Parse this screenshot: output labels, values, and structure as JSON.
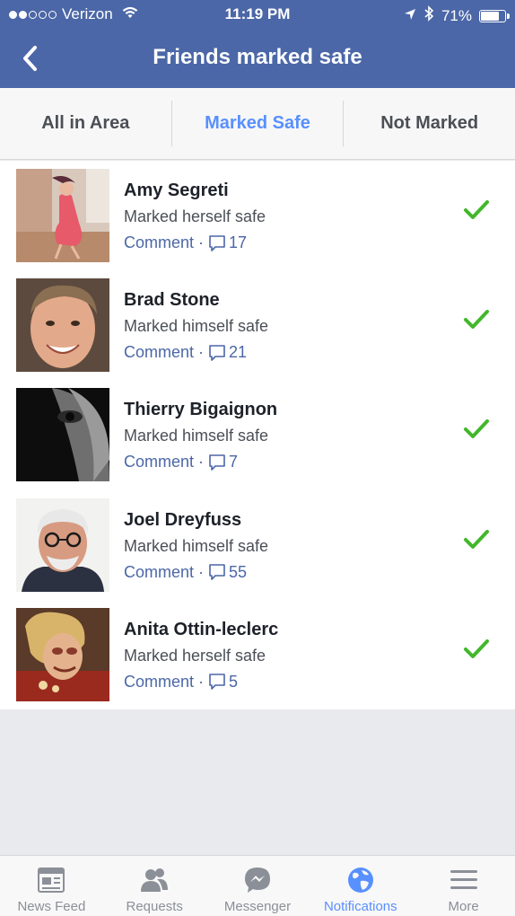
{
  "status": {
    "carrier": "Verizon",
    "time": "11:19 PM",
    "battery": "71%",
    "battery_level": 0.71
  },
  "nav": {
    "title": "Friends marked safe"
  },
  "tabs": [
    {
      "label": "All in Area"
    },
    {
      "label": "Marked Safe"
    },
    {
      "label": "Not Marked"
    }
  ],
  "people": [
    {
      "name": "Amy Segreti",
      "status": "Marked herself safe",
      "comment_label": "Comment",
      "comment_count": "17"
    },
    {
      "name": "Brad Stone",
      "status": "Marked himself safe",
      "comment_label": "Comment",
      "comment_count": "21"
    },
    {
      "name": "Thierry Bigaignon",
      "status": "Marked himself safe",
      "comment_label": "Comment",
      "comment_count": "7"
    },
    {
      "name": "Joel Dreyfuss",
      "status": "Marked himself safe",
      "comment_label": "Comment",
      "comment_count": "55"
    },
    {
      "name": "Anita Ottin-leclerc",
      "status": "Marked herself safe",
      "comment_label": "Comment",
      "comment_count": "5"
    }
  ],
  "tabbar": [
    {
      "label": "News Feed",
      "icon": "news-feed-icon"
    },
    {
      "label": "Requests",
      "icon": "requests-icon"
    },
    {
      "label": "Messenger",
      "icon": "messenger-icon"
    },
    {
      "label": "Notifications",
      "icon": "globe-icon"
    },
    {
      "label": "More",
      "icon": "menu-icon"
    }
  ],
  "colors": {
    "brand": "#4b67a7",
    "active": "#5890ff",
    "check": "#42b72a"
  }
}
